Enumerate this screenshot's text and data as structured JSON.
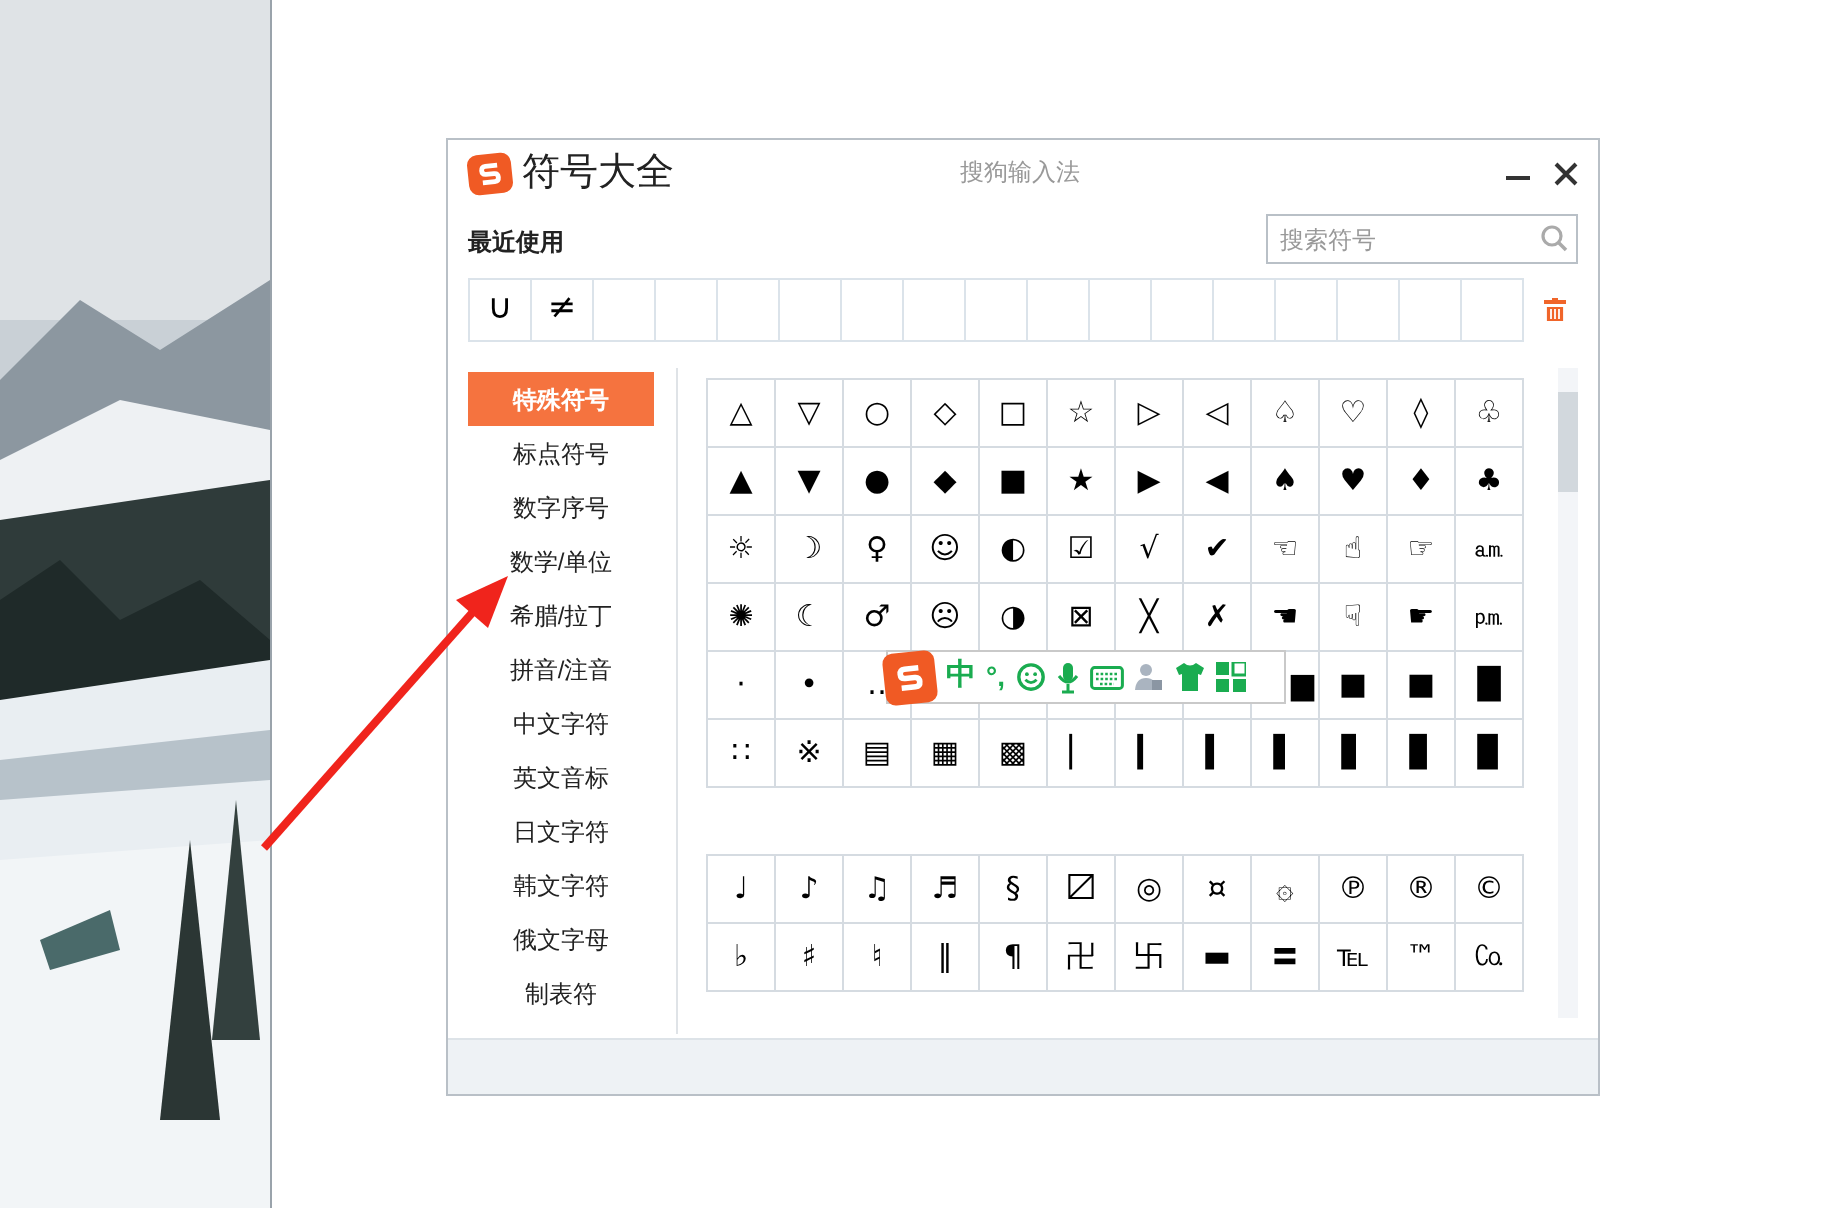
{
  "window": {
    "title": "符号大全",
    "app_name": "搜狗输入法"
  },
  "recent": {
    "label": "最近使用",
    "symbols": [
      "∪",
      "≠"
    ]
  },
  "search": {
    "placeholder": "搜索符号"
  },
  "categories": [
    {
      "label": "特殊符号",
      "selected": true
    },
    {
      "label": "标点符号",
      "selected": false
    },
    {
      "label": "数字序号",
      "selected": false
    },
    {
      "label": "数学/单位",
      "selected": false
    },
    {
      "label": "希腊/拉丁",
      "selected": false
    },
    {
      "label": "拼音/注音",
      "selected": false
    },
    {
      "label": "中文字符",
      "selected": false
    },
    {
      "label": "英文音标",
      "selected": false
    },
    {
      "label": "日文字符",
      "selected": false
    },
    {
      "label": "韩文字符",
      "selected": false
    },
    {
      "label": "俄文字母",
      "selected": false
    },
    {
      "label": "制表符",
      "selected": false
    }
  ],
  "symbol_groups": [
    [
      [
        "△",
        "▽",
        "○",
        "◇",
        "□",
        "☆",
        "▷",
        "◁",
        "♤",
        "♡",
        "◊",
        "♧"
      ],
      [
        "▲",
        "▼",
        "●",
        "◆",
        "■",
        "★",
        "▶",
        "◀",
        "♠",
        "♥",
        "♦",
        "♣"
      ],
      [
        "☼",
        "☽",
        "♀",
        "☺",
        "◐",
        "☑",
        "√",
        "✔",
        "☜",
        "☝",
        "☞",
        "㏂"
      ],
      [
        "✺",
        "☾",
        "♂",
        "☹",
        "◑",
        "⊠",
        "╳",
        "✗",
        "☚",
        "☟",
        "☛",
        "㏘"
      ],
      {
        "start": [
          "·",
          "•",
          "‥"
        ],
        "end": [
          "▆",
          "■",
          "■",
          "█"
        ]
      },
      [
        "∷",
        "※",
        "▤",
        "▦",
        "▩",
        "▏",
        "▎",
        "▍",
        "▌",
        "▋",
        "▊",
        "▉"
      ]
    ],
    [
      [
        "♩",
        "♪",
        "♫",
        "♬",
        "§",
        "〼",
        "◎",
        "¤",
        "۞",
        "℗",
        "®",
        "©"
      ],
      [
        "♭",
        "♯",
        "♮",
        "‖",
        "¶",
        "卍",
        "卐",
        "▬",
        "〓",
        "℡",
        "™",
        "㏇"
      ]
    ]
  ],
  "ime_toolbar": {
    "mode": "中",
    "punctuation": "°,"
  }
}
